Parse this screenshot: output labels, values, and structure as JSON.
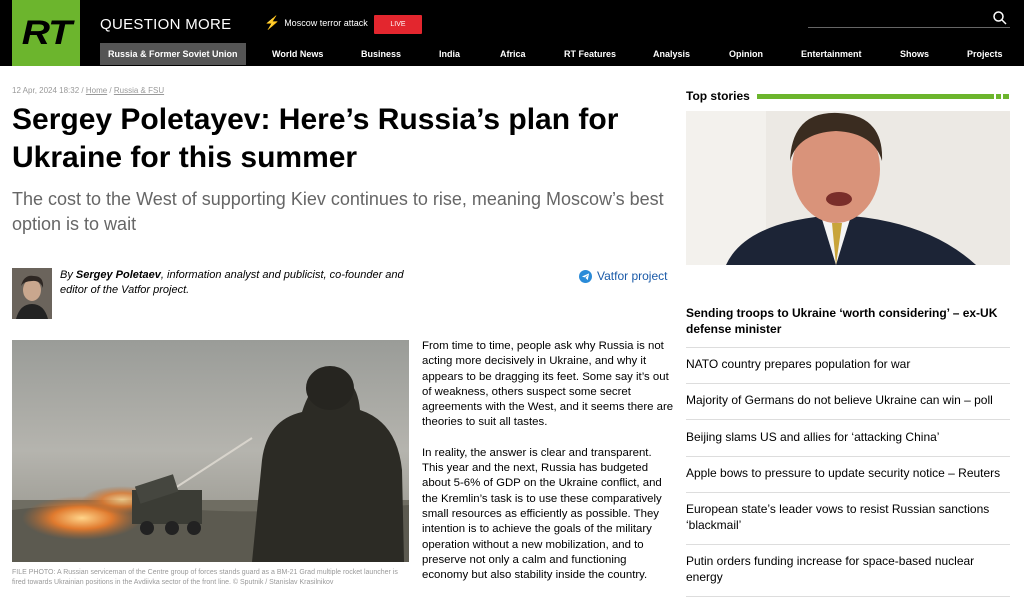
{
  "header": {
    "logo": "RT",
    "brand": "QUESTION MORE",
    "trending": "Moscow terror attack",
    "live": "LIVE",
    "nav": [
      "Russia & Former Soviet Union",
      "World News",
      "Business",
      "India",
      "Africa",
      "RT Features",
      "Analysis",
      "Opinion",
      "Entertainment",
      "Shows",
      "Projects"
    ]
  },
  "article": {
    "date": "12 Apr, 2024 18:32",
    "breadcrumb": [
      "Home",
      "Russia & FSU"
    ],
    "title": "Sergey Poletayev: Here’s Russia’s plan for Ukraine for this summer",
    "subtitle": "The cost to the West of supporting Kiev continues to rise, meaning Moscow’s best option is to wait",
    "author_prefix": "By ",
    "author_name": "Sergey Poletaev",
    "author_desc": ", information analyst and publicist, co-founder and editor of the Vatfor project.",
    "project_link": "Vatfor project",
    "caption": "FILE PHOTO: A Russian serviceman of the Centre group of forces stands guard as a BM-21 Grad multiple rocket launcher is fired towards Ukrainian positions in the Avdiivka sector of the front line. © Sputnik / Stanislav Krasilnikov",
    "paragraphs": [
      "From time to time, people ask why Russia is not acting more decisively in Ukraine, and why it appears to be dragging its feet. Some say it’s out of weakness, others suspect some secret agreements with the West, and it seems there are theories to suit all tastes.",
      "In reality, the answer is clear and transparent. This year and the next, Russia has budgeted about 5-6% of GDP on the Ukraine conflict, and the Kremlin’s task is to use these comparatively small resources as efficiently as possible. They intention is to achieve the goals of the military operation without a new mobilization, and to preserve not only a calm and functioning economy but also stability inside the country."
    ]
  },
  "sidebar": {
    "heading": "Top stories",
    "lead": "Sending troops to Ukraine ‘worth considering’ – ex-UK defense minister",
    "stories": [
      "NATO country prepares population for war",
      "Majority of Germans do not believe Ukraine can win – poll",
      "Beijing slams US and allies for ‘attacking China’",
      "Apple bows to pressure to update security notice – Reuters",
      "European state’s leader vows to resist Russian sanctions ‘blackmail’",
      "Putin orders funding increase for space-based nuclear energy"
    ]
  },
  "colors": {
    "brand_green": "#6cb52d",
    "live_red": "#e3262e",
    "link_blue": "#1a5aa8"
  },
  "icons": [
    "search-icon",
    "lightning-icon",
    "telegram-icon"
  ]
}
